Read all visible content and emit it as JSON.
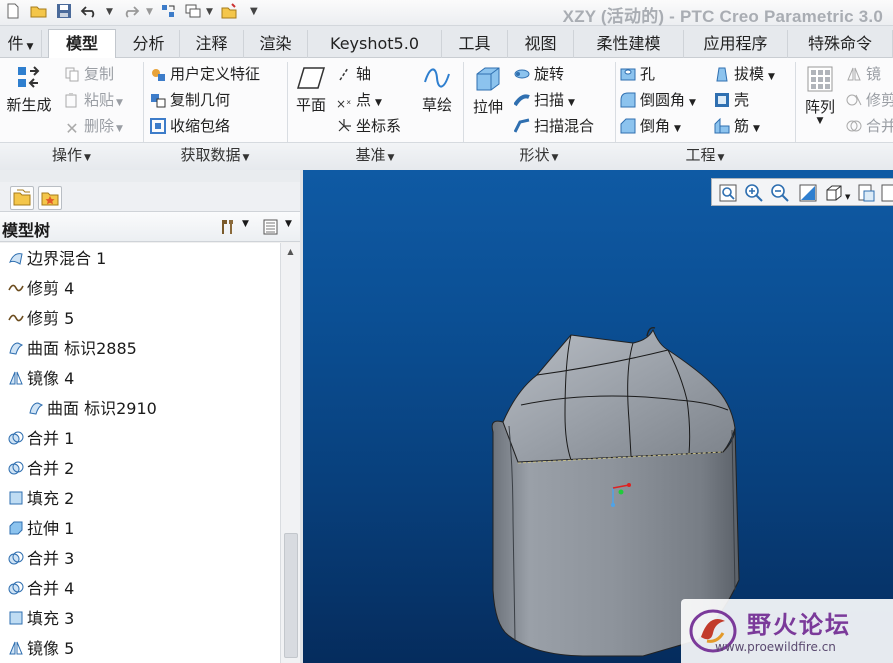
{
  "window": {
    "title": "XZY (活动的) - PTC Creo Parametric 3.0"
  },
  "tabs": [
    {
      "label": "件",
      "dropdown": true
    },
    {
      "label": "模型",
      "active": true
    },
    {
      "label": "分析"
    },
    {
      "label": "注释"
    },
    {
      "label": "渲染"
    },
    {
      "label": "Keyshot5.0"
    },
    {
      "label": "工具"
    },
    {
      "label": "视图"
    },
    {
      "label": "柔性建模"
    },
    {
      "label": "应用程序"
    },
    {
      "label": "特殊命令"
    }
  ],
  "ribbon": {
    "operations": {
      "regenerate": "新生成",
      "copy": "复制",
      "paste": "粘贴",
      "delete": "删除",
      "label": "操作"
    },
    "get_data": {
      "udf": "用户定义特征",
      "copy_geom": "复制几何",
      "shrinkwrap": "收缩包络",
      "label": "获取数据"
    },
    "datum": {
      "plane": "平面",
      "axis": "轴",
      "point": "点",
      "csys": "坐标系",
      "sketch": "草绘",
      "label": "基准"
    },
    "shapes": {
      "extrude": "拉伸",
      "revolve": "旋转",
      "sweep": "扫描",
      "swept_blend": "扫描混合",
      "label": "形状"
    },
    "engineering": {
      "hole": "孔",
      "round": "倒圆角",
      "chamfer": "倒角",
      "draft": "拔模",
      "shell": "壳",
      "rib": "筋",
      "label": "工程"
    },
    "editing": {
      "pattern": "阵列",
      "mirror": "镜",
      "trim": "修剪",
      "merge": "合并"
    }
  },
  "model_tree": {
    "title": "模型树",
    "items": [
      {
        "label": "边界混合 1",
        "icon": "boundary-blend-icon",
        "indent": 0
      },
      {
        "label": "修剪 4",
        "icon": "trim-icon",
        "indent": 0
      },
      {
        "label": "修剪 5",
        "icon": "trim-icon",
        "indent": 0
      },
      {
        "label": "曲面 标识2885",
        "icon": "surface-icon",
        "indent": 0
      },
      {
        "label": "镜像 4",
        "icon": "mirror-icon",
        "indent": 0
      },
      {
        "label": "曲面 标识2910",
        "icon": "surface-icon",
        "indent": 1
      },
      {
        "label": "合并 1",
        "icon": "merge-icon",
        "indent": 0
      },
      {
        "label": "合并 2",
        "icon": "merge-icon",
        "indent": 0
      },
      {
        "label": "填充 2",
        "icon": "fill-icon",
        "indent": 0
      },
      {
        "label": "拉伸 1",
        "icon": "extrude-icon",
        "indent": 0
      },
      {
        "label": "合并 3",
        "icon": "merge-icon",
        "indent": 0
      },
      {
        "label": "合并 4",
        "icon": "merge-icon",
        "indent": 0
      },
      {
        "label": "填充 3",
        "icon": "fill-icon",
        "indent": 0
      },
      {
        "label": "镜像 5",
        "icon": "mirror-icon",
        "indent": 0
      }
    ]
  },
  "watermark": {
    "title": "野火论坛",
    "url": "www.proewildfire.cn"
  },
  "colors": {
    "viewport_top": "#0f5aa4",
    "viewport_bottom": "#052c5d",
    "model_gray": "#8e949c",
    "accent_blue": "#2f7fcf"
  }
}
